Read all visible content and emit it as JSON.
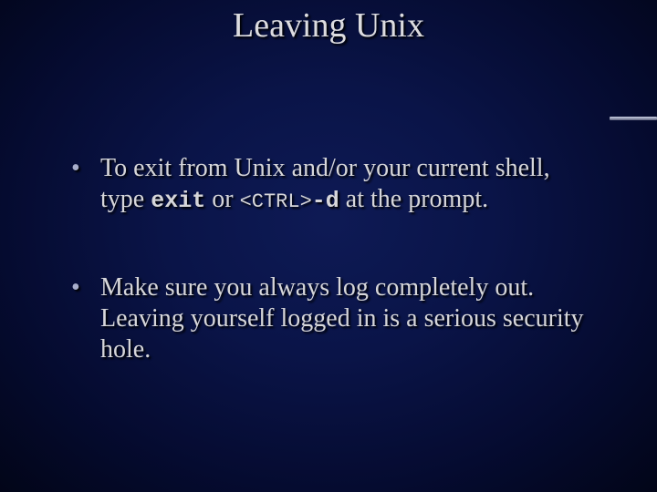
{
  "slide": {
    "title": "Leaving Unix",
    "bullets": [
      {
        "pre": "To exit from Unix and/or your current shell, type ",
        "code1": "exit",
        "mid1": " or ",
        "code2": "<CTRL>",
        "code3": "-d",
        "post": " at the prompt."
      },
      {
        "text": "Make sure you always log completely out. Leaving yourself logged in is a serious security hole."
      }
    ]
  }
}
